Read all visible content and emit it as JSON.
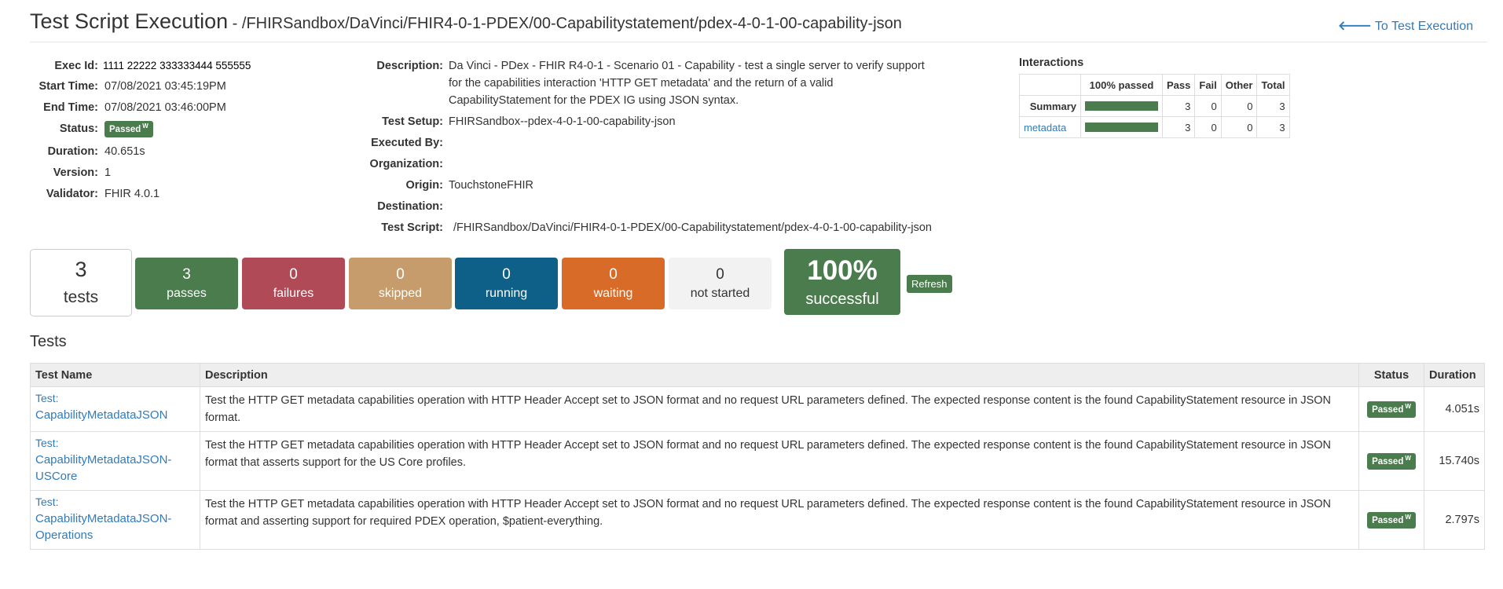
{
  "header": {
    "title": "Test Script Execution",
    "dash": " - ",
    "path": "/FHIRSandbox/DaVinci/FHIR4-0-1-PDEX/00-Capabilitystatement/pdex-4-0-1-00-capability-json",
    "to_exec_icon": "arrow-left-icon",
    "to_exec_label": "To Test Execution"
  },
  "left_info": {
    "exec_id_label": "Exec Id:",
    "exec_id": "1111 22222 333333444 555555",
    "start_label": "Start Time:",
    "start": "07/08/2021 03:45:19PM",
    "end_label": "End Time:",
    "end": "07/08/2021 03:46:00PM",
    "status_label": "Status:",
    "status": "Passed",
    "status_sup": "W",
    "duration_label": "Duration:",
    "duration": "40.651s",
    "version_label": "Version:",
    "version": "1",
    "validator_label": "Validator:",
    "validator": "FHIR 4.0.1"
  },
  "mid_info": {
    "description_label": "Description:",
    "description_lines": [
      "Da Vinci - PDex - FHIR R4-0-1 - Scenario 01 - Capability - test a single server to verify support",
      "for the capabilities interaction 'HTTP GET metadata' and the return of a valid",
      "CapabilityStatement for the PDEX IG using JSON syntax."
    ],
    "test_setup_label": "Test Setup:",
    "test_setup": "FHIRSandbox--pdex-4-0-1-00-capability-json",
    "executed_by_label": "Executed By:",
    "organization_label": "Organization:",
    "origin_label": "Origin:",
    "origin": "TouchstoneFHIR",
    "destination_label": "Destination:",
    "test_script_label": "Test Script:",
    "test_script": "/FHIRSandbox/DaVinci/FHIR4-0-1-PDEX/00-Capabilitystatement/pdex-4-0-1-00-capability-json"
  },
  "interactions": {
    "title": "Interactions",
    "headers": [
      "",
      "100% passed",
      "Pass",
      "Fail",
      "Other",
      "Total"
    ],
    "rows": [
      {
        "label": "Summary",
        "passed_fraction": 1.0,
        "pass": "3",
        "fail": "0",
        "other": "0",
        "total": "3"
      },
      {
        "label": "metadata",
        "passed_fraction": 1.0,
        "pass": "3",
        "fail": "0",
        "other": "0",
        "total": "3"
      }
    ]
  },
  "stats": {
    "tests_count": "3",
    "tests_label": "tests",
    "passes": "3",
    "passes_label": "passes",
    "failures": "0",
    "failures_label": "failures",
    "skipped": "0",
    "skipped_label": "skipped",
    "running": "0",
    "running_label": "running",
    "waiting": "0",
    "waiting_label": "waiting",
    "not_started": "0",
    "not_started_label": "not started",
    "success_pct": "100%",
    "success_label": "successful",
    "refresh_label": "Refresh"
  },
  "colors": {
    "passes": "#4a7c4d",
    "failures": "#b04a57",
    "skipped": "#c69c6d",
    "running": "#0f6089",
    "waiting": "#d96b29",
    "not_started": "#f2f2f2",
    "success": "#4a7c4d"
  },
  "tests": {
    "heading": "Tests",
    "columns": [
      "Test Name",
      "Description",
      "Status",
      "Duration"
    ],
    "rows": [
      {
        "name_lines": [
          "Test:",
          "CapabilityMetadataJSON"
        ],
        "description": "Test the HTTP GET metadata capabilities operation with HTTP Header Accept set to JSON format and no request URL parameters defined. The expected response content is the found CapabilityStatement resource in JSON format.",
        "status": "Passed",
        "status_sup": "W",
        "duration": "4.051s"
      },
      {
        "name_lines": [
          "Test:",
          "CapabilityMetadataJSON-",
          "USCore"
        ],
        "description": "Test the HTTP GET metadata capabilities operation with HTTP Header Accept set to JSON format and no request URL parameters defined. The expected response content is the found CapabilityStatement resource in JSON format that asserts support for the US Core profiles.",
        "status": "Passed",
        "status_sup": "W",
        "duration": "15.740s"
      },
      {
        "name_lines": [
          "Test:",
          "CapabilityMetadataJSON-",
          "Operations"
        ],
        "description": "Test the HTTP GET metadata capabilities operation with HTTP Header Accept set to JSON format and no request URL parameters defined. The expected response content is the found CapabilityStatement resource in JSON format and asserting support for required PDEX operation, $patient-everything.",
        "status": "Passed",
        "status_sup": "W",
        "duration": "2.797s"
      }
    ]
  }
}
